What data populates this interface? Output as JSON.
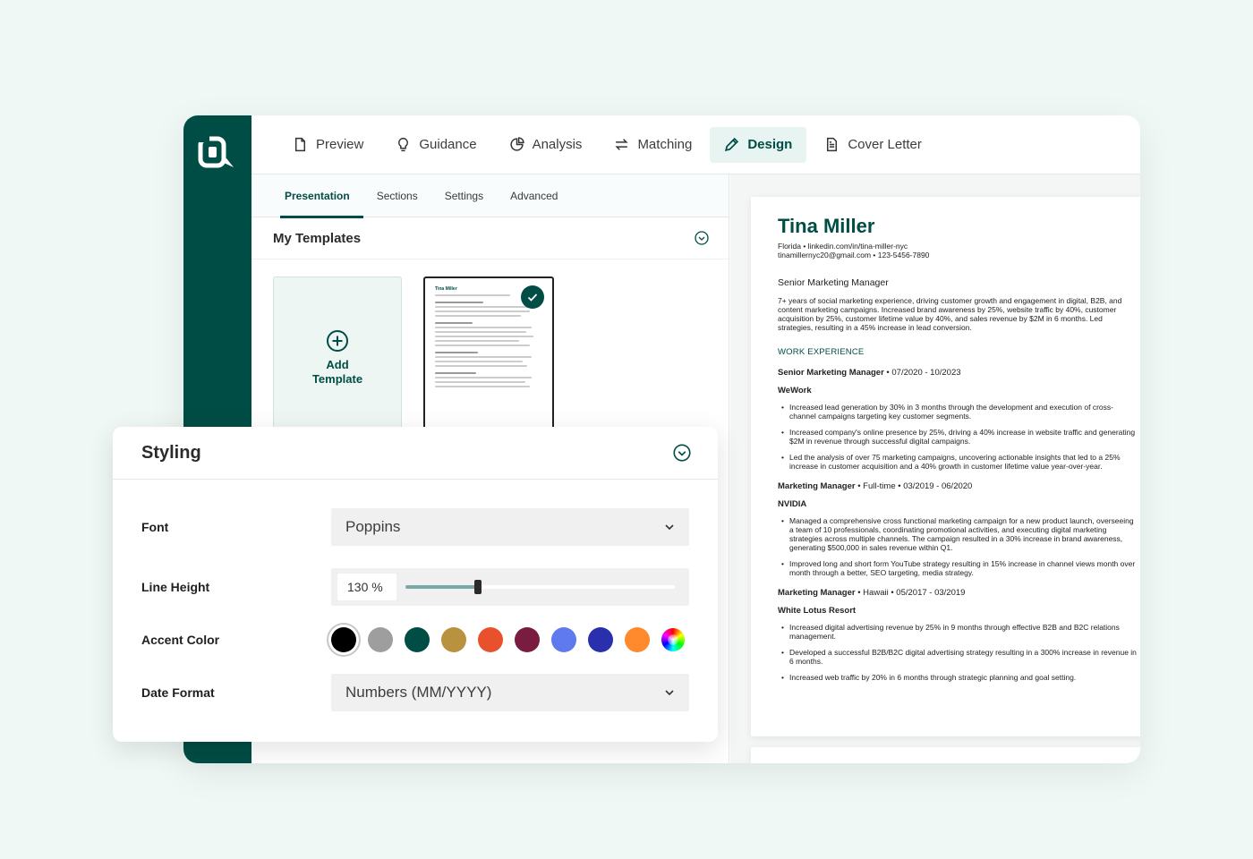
{
  "nav": {
    "items": [
      {
        "label": "Preview",
        "icon": "file-icon"
      },
      {
        "label": "Guidance",
        "icon": "lightbulb-icon"
      },
      {
        "label": "Analysis",
        "icon": "pie-chart-icon"
      },
      {
        "label": "Matching",
        "icon": "swap-icon"
      },
      {
        "label": "Design",
        "icon": "pencil-icon",
        "active": true
      },
      {
        "label": "Cover Letter",
        "icon": "document-icon"
      }
    ]
  },
  "subtabs": [
    "Presentation",
    "Sections",
    "Settings",
    "Advanced"
  ],
  "templates": {
    "title": "My Templates",
    "add_label_1": "Add",
    "add_label_2": "Template",
    "thumb_name": "Tina Miller"
  },
  "styling": {
    "title": "Styling",
    "font_label": "Font",
    "font_value": "Poppins",
    "line_height_label": "Line Height",
    "line_height_value": "130 %",
    "line_height_fraction": 0.27,
    "accent_label": "Accent Color",
    "accent_colors": [
      "#000000",
      "#9e9e9e",
      "#004d45",
      "#b8923e",
      "#e9502c",
      "#7a1c3f",
      "#5f79ee",
      "#2a2fae",
      "#ff8a2e"
    ],
    "accent_selected_index": 0,
    "date_label": "Date Format",
    "date_value": "Numbers (MM/YYYY)"
  },
  "resume": {
    "name": "Tina Miller",
    "contact_1": "Florida  •  linkedin.com/in/tina-miller-nyc",
    "contact_2": "tinamillernyc20@gmail.com   •   123-5456-7890",
    "role": "Senior Marketing Manager",
    "summary": "7+ years of social marketing experience, driving customer growth and engagement in digital, B2B, and content marketing campaigns. Increased brand awareness by 25%, website traffic by 40%, customer acquisition by 25%, customer lifetime value by 40%, and sales revenue by $2M in 6 months. Led strategies, resulting in a 45% increase in lead conversion.",
    "section_title": "WORK EXPERIENCE",
    "jobs": [
      {
        "title": "Senior Marketing Manager",
        "meta": " • 07/2020 - 10/2023",
        "company": "WeWork",
        "bullets": [
          "Increased lead generation by 30% in 3 months through the development and execution of cross-channel campaigns targeting key customer segments.",
          "Increased company's online presence by 25%, driving a 40% increase in website traffic and generating $2M in revenue through successful digital campaigns.",
          "Led the analysis of over 75 marketing campaigns, uncovering actionable insights that led to a 25% increase in customer acquisition and a 40% growth in customer lifetime value year-over-year."
        ]
      },
      {
        "title": "Marketing Manager",
        "meta": " • Full-time • 03/2019 - 06/2020",
        "company": "NVIDIA",
        "bullets": [
          "Managed a comprehensive cross functional marketing campaign for a new product launch, overseeing a team of 10 professionals, coordinating promotional activities, and executing digital marketing strategies across multiple channels. The campaign resulted in a 30% increase in brand awareness, generating $500,000 in sales revenue within Q1.",
          "Improved long and short form YouTube strategy resulting in 15% increase in channel views month over month through a better, SEO targeting, media strategy."
        ]
      },
      {
        "title": "Marketing Manager",
        "meta": " • Hawaii • 05/2017 - 03/2019",
        "company": "White Lotus Resort",
        "bullets": [
          "Increased digital advertising revenue by 25% in 9 months through effective B2B and B2C relations management.",
          "Developed a successful B2B/B2C digital advertising strategy resulting in a 300% increase in revenue in 6 months.",
          "Increased web traffic by 20% in 6 months through strategic planning and goal setting."
        ]
      }
    ]
  }
}
